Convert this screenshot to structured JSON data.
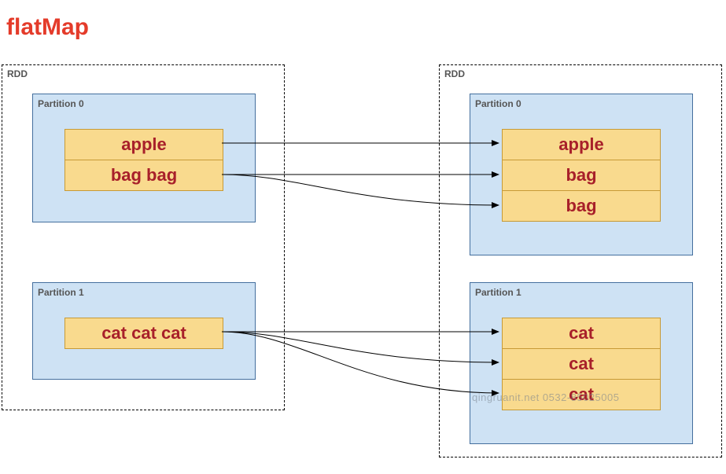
{
  "title": "flatMap",
  "left_rdd": {
    "label": "RDD",
    "partitions": [
      {
        "label": "Partition 0",
        "items": [
          "apple",
          "bag bag"
        ]
      },
      {
        "label": "Partition 1",
        "items": [
          "cat cat cat"
        ]
      }
    ]
  },
  "right_rdd": {
    "label": "RDD",
    "partitions": [
      {
        "label": "Partition 0",
        "items": [
          "apple",
          "bag",
          "bag"
        ]
      },
      {
        "label": "Partition 1",
        "items": [
          "cat",
          "cat",
          "cat"
        ]
      }
    ]
  },
  "watermark": "qingruanit.net 0532-85025005"
}
